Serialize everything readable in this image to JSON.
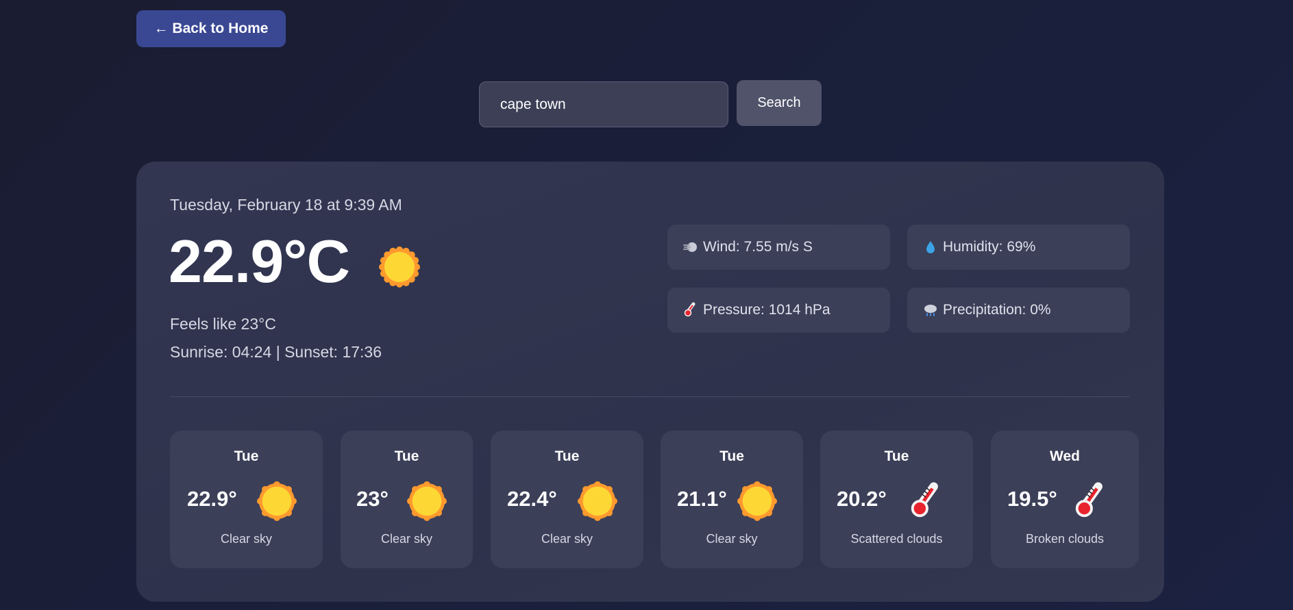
{
  "nav": {
    "back_label": "← Back to Home"
  },
  "search": {
    "value": "cape town",
    "button_label": "Search"
  },
  "current": {
    "datetime": "Tuesday, February 18 at 9:39 AM",
    "temperature": "22.9°C",
    "condition_icon": "sun-icon",
    "feels_like": "Feels like 23°C",
    "sun_times": "Sunrise: 04:24 | Sunset: 17:36"
  },
  "stats": {
    "wind": {
      "icon": "wind-icon",
      "label": "Wind: 7.55 m/s S"
    },
    "humidity": {
      "icon": "droplet-icon",
      "label": "Humidity: 69%"
    },
    "pressure": {
      "icon": "thermometer-icon",
      "label": "Pressure: 1014 hPa"
    },
    "precipitation": {
      "icon": "rain-cloud-icon",
      "label": "Precipitation: 0%"
    }
  },
  "forecast": [
    {
      "day": "Tue",
      "temp": "22.9°",
      "icon": "sun-icon",
      "desc": "Clear sky"
    },
    {
      "day": "Tue",
      "temp": "23°",
      "icon": "sun-icon",
      "desc": "Clear sky"
    },
    {
      "day": "Tue",
      "temp": "22.4°",
      "icon": "sun-icon",
      "desc": "Clear sky"
    },
    {
      "day": "Tue",
      "temp": "21.1°",
      "icon": "sun-icon",
      "desc": "Clear sky"
    },
    {
      "day": "Tue",
      "temp": "20.2°",
      "icon": "thermometer-icon",
      "desc": "Scattered clouds"
    },
    {
      "day": "Wed",
      "temp": "19.5°",
      "icon": "thermometer-icon",
      "desc": "Broken clouds"
    }
  ],
  "colors": {
    "background": "#1a1d36",
    "back_button": "#3a4893",
    "card": "#30344e",
    "tile": "#3b3f58",
    "sun_core": "#fdd835",
    "sun_rays": "#ff9a2e",
    "thermo_red": "#e8232d"
  }
}
